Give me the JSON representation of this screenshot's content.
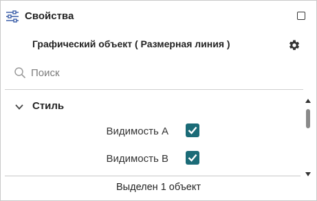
{
  "header": {
    "title": "Свойства",
    "icon": "sliders-icon",
    "window_control_icon": "maximize-icon"
  },
  "object": {
    "title": "Графический объект ( Размерная линия )",
    "settings_icon": "gear-icon"
  },
  "search": {
    "placeholder": "Поиск",
    "value": ""
  },
  "sections": [
    {
      "title": "Стиль",
      "expanded": true,
      "properties": [
        {
          "label": "Видимость А",
          "checked": true
        },
        {
          "label": "Видимость В",
          "checked": true
        }
      ]
    }
  ],
  "status": {
    "text": "Выделен 1 объект"
  },
  "colors": {
    "checkbox_fill": "#1b6b77",
    "accent_icon": "#3b5ea8"
  }
}
